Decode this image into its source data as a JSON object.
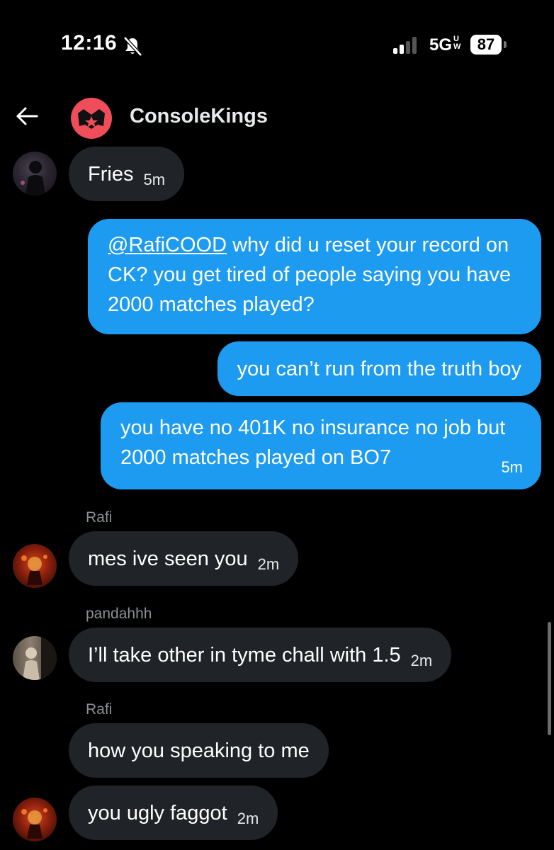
{
  "status_bar": {
    "time": "12:16",
    "network": "5G",
    "network_badge": "UW",
    "battery": "87"
  },
  "header": {
    "back_icon": "arrow-left-icon",
    "group_name": "ConsoleKings"
  },
  "messages": [
    {
      "direction": "in",
      "sender": "",
      "text": "Fries",
      "time": "5m"
    },
    {
      "direction": "out",
      "mention": "@RafiCOOD",
      "text": " why did u reset your record on CK? you get tired of people saying you have 2000 matches played?",
      "time": ""
    },
    {
      "direction": "out",
      "text": "you can’t run from the truth boy",
      "time": ""
    },
    {
      "direction": "out",
      "text": "you have no 401K no insurance no job but 2000 matches played on BO7",
      "time": "5m"
    },
    {
      "direction": "in",
      "sender": "Rafi",
      "text": "mes ive seen you",
      "time": "2m"
    },
    {
      "direction": "in",
      "sender": "pandahhh",
      "text": "I’ll take other in tyme chall with 1.5",
      "time": "2m"
    },
    {
      "direction": "in",
      "sender": "Rafi",
      "text": "how you speaking to me",
      "time": ""
    },
    {
      "direction": "in",
      "sender": "",
      "text": "you ugly faggot",
      "time": "2m"
    }
  ],
  "colors": {
    "background": "#000000",
    "outgoing_bubble": "#1d9bf0",
    "incoming_bubble": "#202327",
    "sender_name": "#8b8f94",
    "group_avatar": "#ef4d5a"
  }
}
